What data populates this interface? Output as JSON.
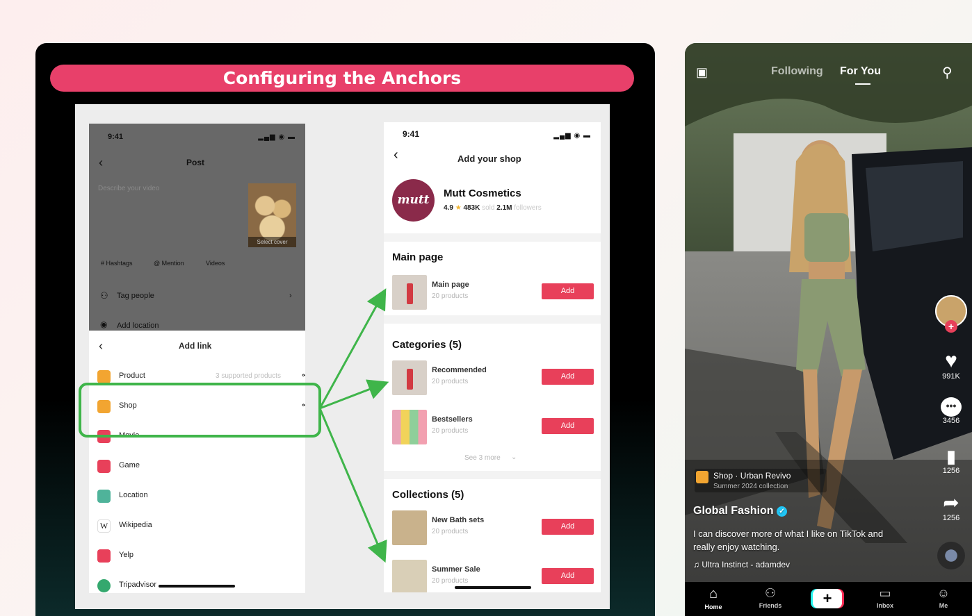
{
  "banner": {
    "title": "Configuring the Anchors"
  },
  "post_screen": {
    "time": "9:41",
    "title": "Post",
    "describe_placeholder": "Describe your video",
    "select_cover": "Select cover",
    "tags": [
      "# Hashtags",
      "@ Mention",
      "Videos"
    ],
    "tag_people": "Tag people",
    "add_location": "Add location",
    "sheet_title": "Add link",
    "links": [
      {
        "label": "Product",
        "extra": "3 supported products",
        "color": "#f2a531"
      },
      {
        "label": "Shop",
        "extra": "",
        "color": "#f2a531"
      },
      {
        "label": "Movie",
        "extra": "",
        "color": "#e8405a"
      },
      {
        "label": "Game",
        "extra": "",
        "color": "#e8405a"
      },
      {
        "label": "Location",
        "extra": "",
        "color": "#4fb39a"
      },
      {
        "label": "Wikipedia",
        "extra": "",
        "color": "#ffffff"
      },
      {
        "label": "Yelp",
        "extra": "",
        "color": "#e8405a"
      },
      {
        "label": "Tripadvisor",
        "extra": "",
        "color": "#34a86e"
      }
    ]
  },
  "shop_screen": {
    "time": "9:41",
    "title": "Add your shop",
    "shop_name": "Mutt Cosmetics",
    "logo_text": "mutt",
    "rating": "4.9",
    "sold": "483K",
    "sold_label": "sold",
    "followers": "2.1M",
    "followers_label": "followers",
    "main_section": "Main page",
    "main_item": {
      "name": "Main page",
      "sub": "20 products"
    },
    "categories_section": "Categories (5)",
    "categories": [
      {
        "name": "Recommended",
        "sub": "20 products"
      },
      {
        "name": "Bestsellers",
        "sub": "20 products"
      }
    ],
    "see_more": "See 3 more",
    "collections_section": "Collections (5)",
    "collections": [
      {
        "name": "New Bath sets",
        "sub": "20 products"
      },
      {
        "name": "Summer Sale",
        "sub": "20 products"
      }
    ],
    "add_label": "Add"
  },
  "tiktok": {
    "tab_following": "Following",
    "tab_foryou": "For You",
    "likes": "991K",
    "comments": "3456",
    "saves": "1256",
    "shares": "1256",
    "shop_anchor": "Shop · Urban Revivo",
    "shop_anchor_sub": "Summer 2024 collection",
    "username": "Global Fashion",
    "caption": "I can discover more of what I like on TikTok and really enjoy watching.",
    "music": "Ultra Instinct - adamdev",
    "nav": [
      {
        "label": "Home"
      },
      {
        "label": "Friends"
      },
      {
        "label": ""
      },
      {
        "label": "Inbox"
      },
      {
        "label": "Me"
      }
    ]
  }
}
